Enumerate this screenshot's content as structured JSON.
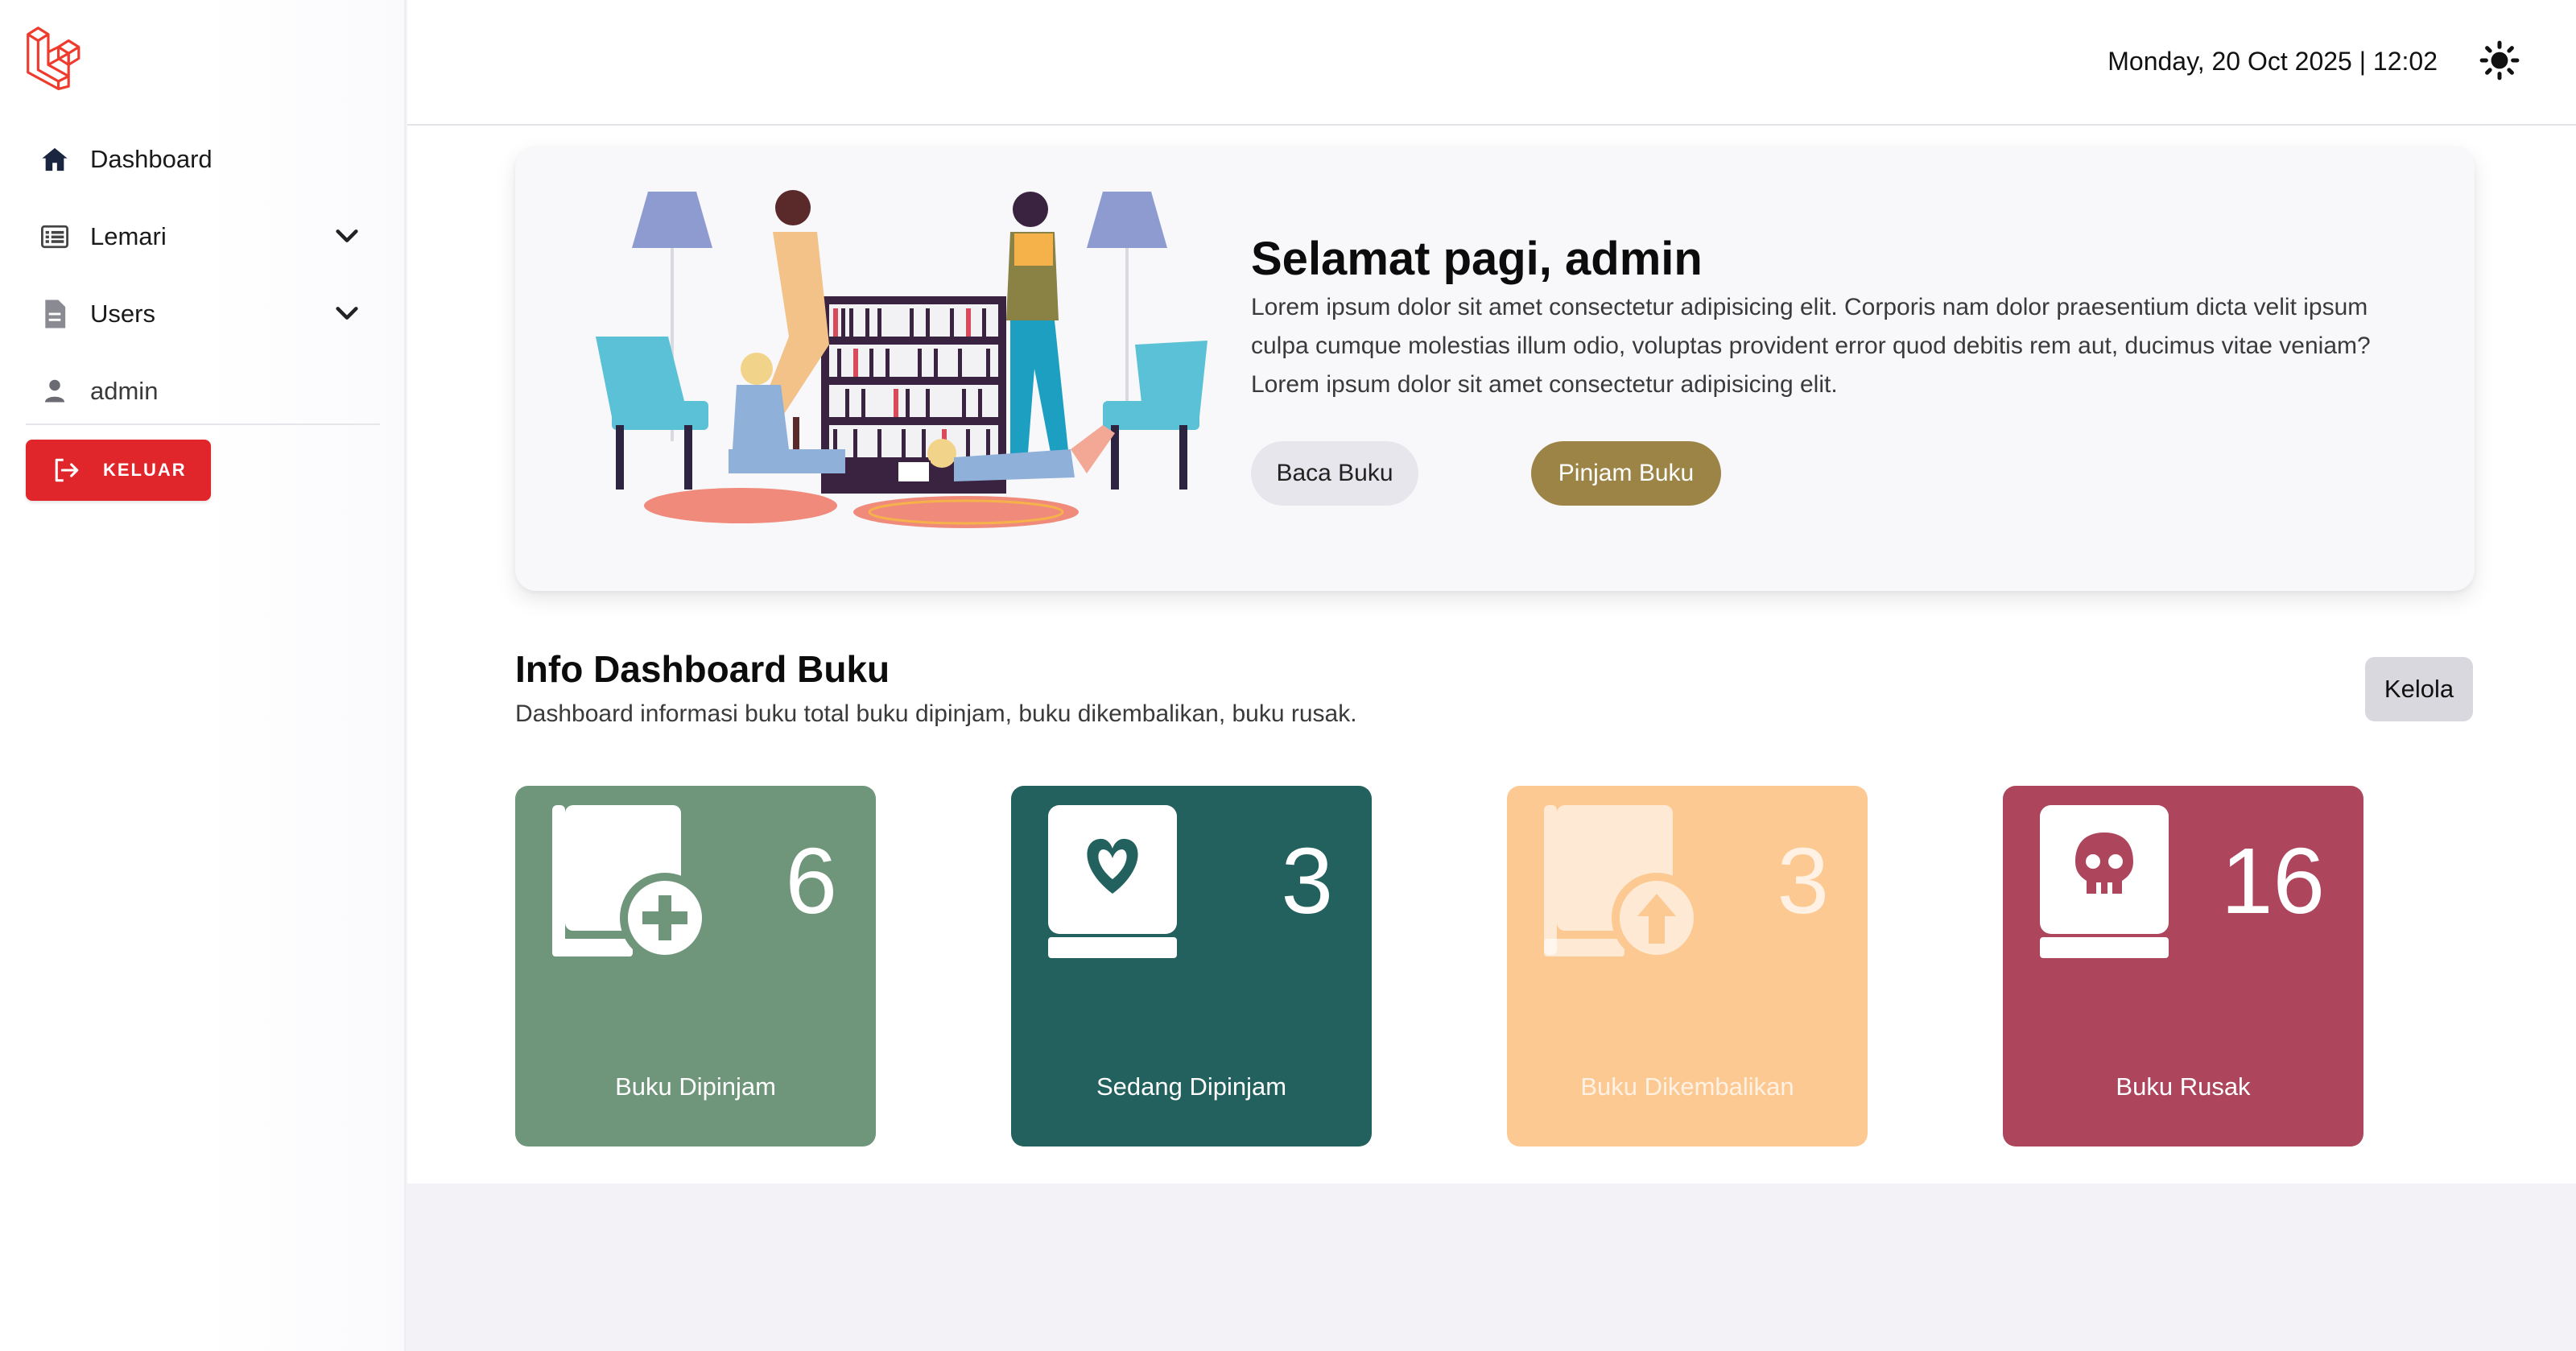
{
  "sidebar": {
    "logo_icon": "laravel-logo-icon",
    "items": [
      {
        "label": "Dashboard",
        "icon": "home-icon"
      },
      {
        "label": "Lemari",
        "icon": "list-icon",
        "expandable": true
      },
      {
        "label": "Users",
        "icon": "document-icon",
        "expandable": true
      },
      {
        "label": "admin",
        "icon": "user-icon"
      }
    ],
    "logout_label": "KELUAR",
    "logout_icon": "logout-icon"
  },
  "header": {
    "datetime": "Monday, 20 Oct 2025 | 12:02",
    "theme_icon": "sun-icon"
  },
  "hero": {
    "title": "Selamat pagi, admin",
    "text": "Lorem ipsum dolor sit amet consectetur adipisicing elit. Corporis nam dolor praesentium dicta velit ipsum culpa cumque molestias illum odio, voluptas provident error quod debitis rem aut, ducimus vitae veniam? Lorem ipsum dolor sit amet consectetur adipisicing elit.",
    "read_button": "Baca Buku",
    "borrow_button": "Pinjam Buku"
  },
  "info": {
    "title": "Info Dashboard Buku",
    "subtitle": "Dashboard informasi buku total buku dipinjam, buku dikembalikan, buku rusak.",
    "manage_button": "Kelola",
    "cards": [
      {
        "label": "Buku Dipinjam",
        "value": "6",
        "color": "#6f967b",
        "icon": "book-plus-icon"
      },
      {
        "label": "Sedang Dipinjam",
        "value": "3",
        "color": "#22615e",
        "icon": "book-heart-icon"
      },
      {
        "label": "Buku Dikembalikan",
        "value": "3",
        "color": "#fdc993",
        "icon": "book-arrow-up-icon"
      },
      {
        "label": "Buku Rusak",
        "value": "16",
        "color": "#ad455d",
        "icon": "book-skull-icon"
      }
    ]
  },
  "colors": {
    "accent_red": "#e0262b",
    "accent_gold": "#9b8445"
  }
}
